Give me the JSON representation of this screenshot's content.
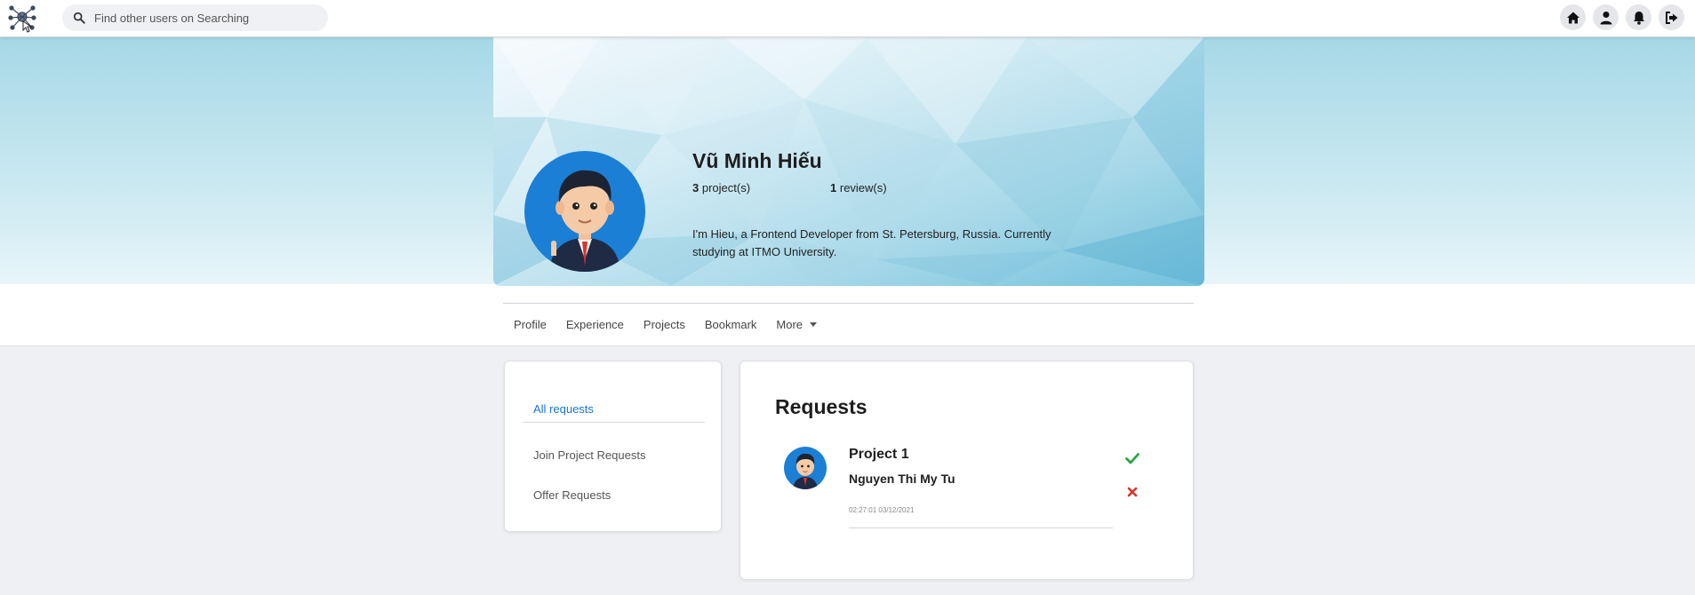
{
  "topbar": {
    "search_placeholder": "Find other users on Searching",
    "icons": [
      "home-icon",
      "user-icon",
      "bell-icon",
      "logout-icon"
    ]
  },
  "profile": {
    "name": "Vũ Minh Hiếu",
    "projects_count": "3",
    "projects_label": "project(s)",
    "reviews_count": "1",
    "reviews_label": "review(s)",
    "bio": "I'm Hieu, a Frontend Developer from St. Petersburg, Russia. Currently studying at ITMO University."
  },
  "tabs": [
    {
      "label": "Profile"
    },
    {
      "label": "Experience"
    },
    {
      "label": "Projects"
    },
    {
      "label": "Bookmark"
    },
    {
      "label": "More"
    }
  ],
  "sidebar": {
    "items": [
      {
        "label": "All requests",
        "active": true
      },
      {
        "label": "Join Project Requests",
        "active": false
      },
      {
        "label": "Offer Requests",
        "active": false
      }
    ]
  },
  "requests": {
    "title": "Requests",
    "items": [
      {
        "project": "Project 1",
        "user": "Nguyen Thi My Tu",
        "time": "02:27:01 03/12/2021"
      }
    ]
  },
  "colors": {
    "accent": "#1a73d9",
    "accept": "#27a844",
    "reject": "#d9342b",
    "avatar_bg": "#1b7fd6"
  }
}
